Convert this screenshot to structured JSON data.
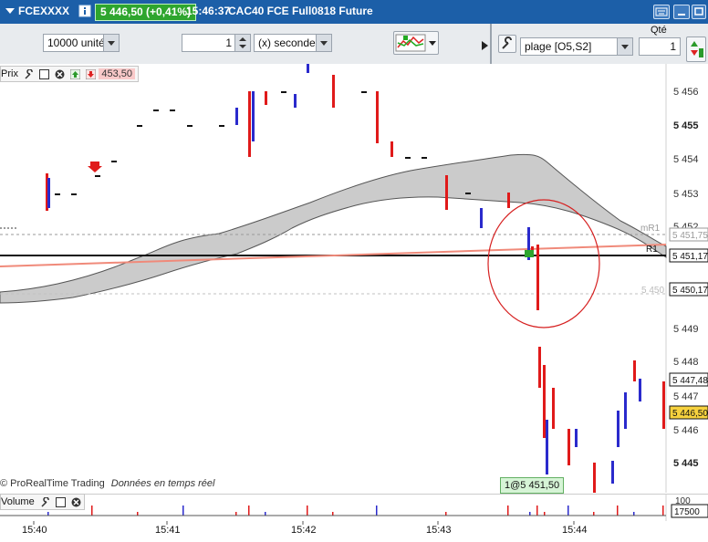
{
  "titlebar": {
    "symbol": "FCEXXXX",
    "price_badge": "5 446,50 (+0,41%)",
    "time": "15:46:37",
    "description": "CAC40 FCE Full0818 Future",
    "accent": "#1c5fa8",
    "badge_color": "#2ea52e"
  },
  "toolbar": {
    "units_value": "10000 unités",
    "interval_value": "1",
    "interval_unit": "(x) secondes",
    "range_value": "plage [O5,S2]",
    "qty_label": "Qté",
    "qty_value": "1"
  },
  "chart": {
    "header_label": "Prix",
    "header_price": "453,50",
    "footer_brand": "© ProRealTime Trading",
    "footer_note": "Données en temps réel",
    "cursor_label": "1@5 451,50",
    "line_labels": {
      "mR1": "mR1",
      "r1": "R1",
      "level_5450": "5 450"
    },
    "price_axis": [
      {
        "label": "5 456",
        "bold": false
      },
      {
        "label": "5 455",
        "bold": true
      },
      {
        "label": "5 454",
        "bold": false
      },
      {
        "label": "5 453",
        "bold": false
      },
      {
        "label": "5 452",
        "bold": false
      },
      {
        "label": "5 449",
        "bold": false
      },
      {
        "label": "5 448",
        "bold": false
      },
      {
        "label": "5 447",
        "bold": false
      },
      {
        "label": "5 446",
        "bold": false
      },
      {
        "label": "5 445",
        "bold": true
      }
    ],
    "tags": {
      "mr1_value": "5 451,75",
      "black_line_value": "5 451,17",
      "level_value": "5 450,17",
      "upper_value": "5 447,48",
      "last_value": "5 446,50"
    },
    "colors": {
      "up": "#2a2acc",
      "down": "#e01a1a",
      "cloud": "#c9c9c9",
      "trend": "#f08a7a",
      "circle": "#d62020",
      "last_tag": "#f7d23e"
    }
  },
  "volume": {
    "label": "Volume",
    "axis_top": "100",
    "axis_value": "17500"
  },
  "time_axis": [
    "15:40",
    "15:41",
    "15:42",
    "15:43",
    "15:44"
  ]
}
